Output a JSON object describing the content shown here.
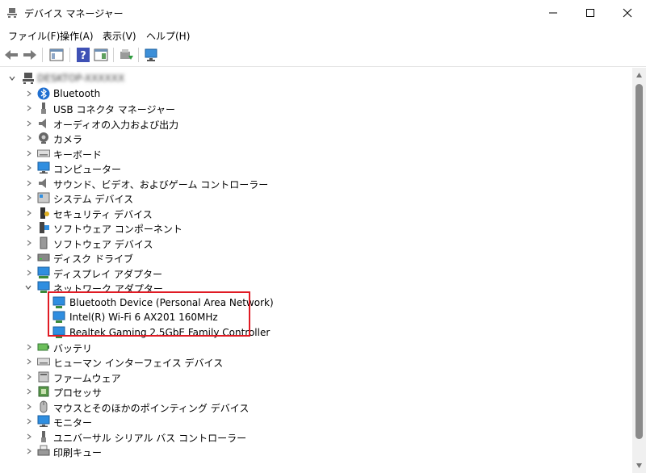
{
  "window": {
    "title": "デバイス マネージャー"
  },
  "menu": [
    "ファイル(F)",
    "操作(A)",
    "表示(V)",
    "ヘルプ(H)"
  ],
  "tree": {
    "root": "DESKTOP-XXXXXX",
    "categories": [
      "Bluetooth",
      "USB コネクタ マネージャー",
      "オーディオの入力および出力",
      "カメラ",
      "キーボード",
      "コンピューター",
      "サウンド、ビデオ、およびゲーム コントローラー",
      "システム デバイス",
      "セキュリティ デバイス",
      "ソフトウェア コンポーネント",
      "ソフトウェア デバイス",
      "ディスク ドライブ",
      "ディスプレイ アダプター",
      "ネットワーク アダプター"
    ],
    "network_adapters": [
      "Bluetooth Device (Personal Area Network)",
      "Intel(R) Wi-Fi 6 AX201 160MHz",
      "Realtek Gaming 2.5GbE Family Controller"
    ],
    "categories_after": [
      "バッテリ",
      "ヒューマン インターフェイス デバイス",
      "ファームウェア",
      "プロセッサ",
      "マウスとそのほかのポインティング デバイス",
      "モニター",
      "ユニバーサル シリアル バス コントローラー",
      "印刷キュー"
    ]
  },
  "colors": {
    "highlight_box": "#e01b24",
    "accent": "#0078d4"
  }
}
